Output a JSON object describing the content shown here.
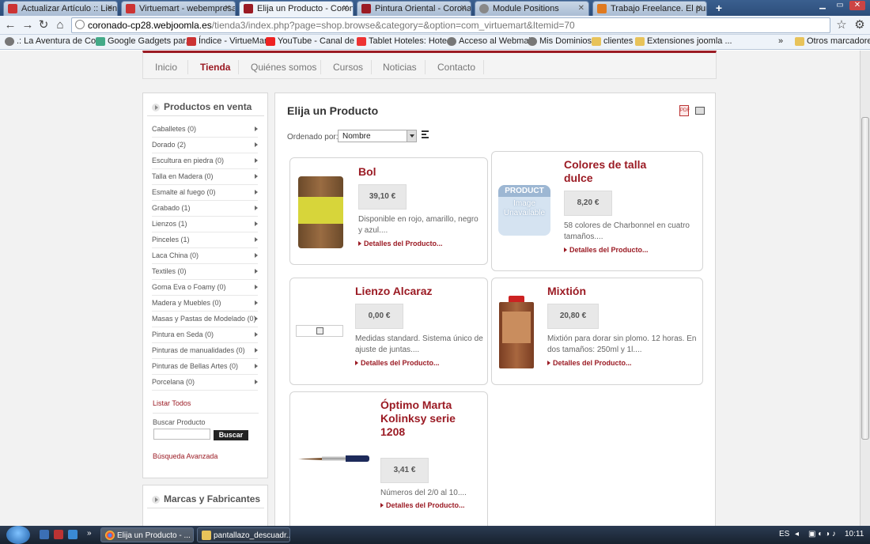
{
  "browser": {
    "tabs": [
      {
        "title": "Actualizar Artículo :: Lienzo",
        "color": "#c33"
      },
      {
        "title": "Virtuemart - webempresa.ju",
        "color": "#c33"
      },
      {
        "title": "Elija un Producto - Corona",
        "color": "#9b1b24"
      },
      {
        "title": "Pintura Oriental - Coronado",
        "color": "#9b1b24"
      },
      {
        "title": "Module Positions",
        "color": "#888"
      },
      {
        "title": "Trabajo Freelance. El punto",
        "color": "#e07a20"
      }
    ],
    "url_host": "coronado-cp28.webjoomla.es",
    "url_path": "/tienda3/index.php?page=shop.browse&category=&option=com_virtuemart&Itemid=70",
    "bookmarks": [
      ".: La Aventura de Co...",
      "Google Gadgets par...",
      "Índice - VirtueMart",
      "YouTube - Canal de ...",
      "Tablet Hoteles: Hote...",
      "Acceso al Webmail",
      "Mis Dominios",
      "clientes",
      "Extensiones joomla ..."
    ],
    "bookmarks_more": "»",
    "other_bookmarks": "Otros marcadores"
  },
  "menu": [
    "Inicio",
    "Tienda",
    "Quiénes somos",
    "Cursos",
    "Noticias",
    "Contacto"
  ],
  "sidebar": {
    "title": "Productos en venta",
    "categories": [
      "Caballetes (0)",
      "Dorado (2)",
      "Escultura en piedra (0)",
      "Talla en Madera (0)",
      "Esmalte al fuego (0)",
      "Grabado (1)",
      "Lienzos (1)",
      "Pinceles (1)",
      "Laca China (0)",
      "Textiles (0)",
      "Goma Eva o Foamy (0)",
      "Madera y Muebles (0)",
      "Masas y Pastas de Modelado (0)",
      "Pintura en Seda (0)",
      "Pinturas de manualidades (0)",
      "Pinturas de Bellas Artes (0)",
      "Porcelana (0)"
    ],
    "list_all": "Listar Todos",
    "search_label": "Buscar Producto",
    "search_button": "Buscar",
    "advanced_search": "Búsqueda Avanzada",
    "brands_title": "Marcas y Fabricantes"
  },
  "main": {
    "title": "Elija un Producto",
    "sort_label": "Ordenado por:",
    "sort_value": "Nombre",
    "products": [
      {
        "name": "Bol",
        "price": "39,10 €",
        "desc": "Disponible en rojo, amarillo, negro y azul....",
        "link": "Detalles del Producto..."
      },
      {
        "name": "Colores de talla dulce",
        "price": "8,20 €",
        "desc": "58 colores de Charbonnel en cuatro tamaños....",
        "link": "Detalles del Producto...",
        "placeholder_top": "PRODUCT",
        "placeholder_bottom": "Image Unavailable"
      },
      {
        "name": "Lienzo Alcaraz",
        "price": "0,00 €",
        "desc": "Medidas standard. Sistema único de ajuste de juntas....",
        "link": "Detalles del Producto..."
      },
      {
        "name": "Mixtión",
        "price": "20,80 €",
        "desc": "Mixtión para dorar sin plomo. 12 horas. En dos tamaños: 250ml y 1l....",
        "link": "Detalles del Producto..."
      },
      {
        "name": "Óptimo Marta Kolinksy serie 1208",
        "price": "3,41 €",
        "desc": "Números del 2/0 al 10....",
        "link": "Detalles del Producto..."
      }
    ]
  },
  "taskbar": {
    "tasks": [
      "Elija un Producto - ...",
      "pantallazo_descuadr..."
    ],
    "lang": "ES",
    "time": "10:11"
  }
}
